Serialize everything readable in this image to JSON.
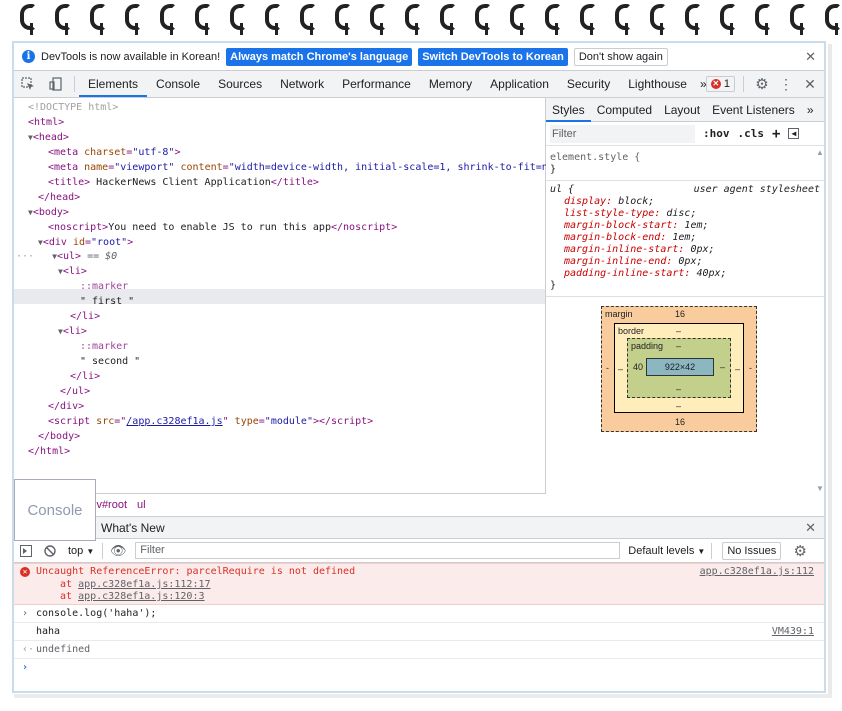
{
  "infobar": {
    "message": "DevTools is now available in Korean!",
    "btn_match": "Always match Chrome's language",
    "btn_switch": "Switch DevTools to Korean",
    "btn_dont_show": "Don't show again",
    "close": "✕"
  },
  "toolbar": {
    "tabs": [
      "Elements",
      "Console",
      "Sources",
      "Network",
      "Performance",
      "Memory",
      "Application",
      "Security",
      "Lighthouse"
    ],
    "more": "»",
    "error_count": "1",
    "close": "✕"
  },
  "elements": {
    "lines": {
      "doctype": "<!DOCTYPE html>",
      "html_open": "<html>",
      "head_open": "<head>",
      "meta_charset_attr": "charset",
      "meta_charset_val": "\"utf-8\"",
      "meta_vp_name_attr": "name",
      "meta_vp_name_val": "\"viewport\"",
      "meta_vp_content_attr": "content",
      "meta_vp_content_val": "\"width=device-width, initial-scale=1, shrink-to-fit=no\"",
      "title_text": " HackerNews Client Application",
      "noscript_text": "You need to enable JS to run this app",
      "div_id_attr": "id",
      "div_id_val": "\"root\"",
      "ul_eq": "== $0",
      "marker": "::marker",
      "li1_text": "\" first \"",
      "li2_text": "\" second \"",
      "script_src_attr": "src",
      "script_src_val": "/app.c328ef1a.js",
      "script_type_attr": "type",
      "script_type_val": "\"module\""
    },
    "crumbs": [
      "iv#root",
      "ul"
    ]
  },
  "styles": {
    "tabs": [
      "Styles",
      "Computed",
      "Layout",
      "Event Listeners"
    ],
    "more": "»",
    "filter_placeholder": "Filter",
    "hov": ":hov",
    "cls": ".cls",
    "element_style": "element.style {",
    "close_brace": "}",
    "ul_selector": "ul {",
    "ua_label": "user agent stylesheet",
    "props": [
      {
        "name": "display",
        "value": "block;"
      },
      {
        "name": "list-style-type",
        "value": "disc;"
      },
      {
        "name": "margin-block-start",
        "value": "1em;"
      },
      {
        "name": "margin-block-end",
        "value": "1em;"
      },
      {
        "name": "margin-inline-start",
        "value": "0px;"
      },
      {
        "name": "margin-inline-end",
        "value": "0px;"
      },
      {
        "name": "padding-inline-start",
        "value": "40px;"
      }
    ],
    "box_model": {
      "margin_label": "margin",
      "margin_top": "16",
      "margin_bottom": "16",
      "margin_left": "-",
      "margin_right": "-",
      "border_label": "border",
      "border_top": "–",
      "border_bottom": "–",
      "border_left": "–",
      "border_right": "–",
      "padding_label": "padding",
      "padding_top": "–",
      "padding_bottom": "–",
      "padding_left": "40",
      "padding_right": "–",
      "content": "922×42"
    }
  },
  "drawer": {
    "console_tab": "Console",
    "whats_new": "What's New",
    "close": "✕",
    "context": "top",
    "filter_placeholder": "Filter",
    "levels": "Default levels",
    "no_issues": "No Issues"
  },
  "console": {
    "error_msg": "Uncaught ReferenceError: parcelRequire is not defined",
    "error_src": "app.c328ef1a.js:112",
    "stack1_prefix": "at ",
    "stack1": "app.c328ef1a.js:112:17",
    "stack2_prefix": "at ",
    "stack2": "app.c328ef1a.js:120:3",
    "input": "console.log('haha');",
    "output": "haha",
    "output_src": "VM439:1",
    "return_val": "undefined"
  },
  "colors": {
    "accent": "#1a73e8",
    "error": "#d93025",
    "tag": "#881280"
  }
}
